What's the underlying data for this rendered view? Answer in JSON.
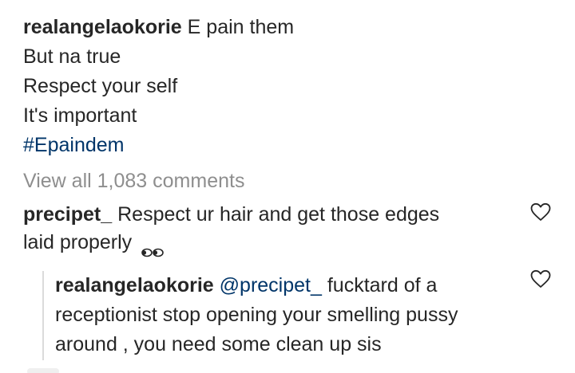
{
  "caption": {
    "username": "realangelaokorie",
    "first_line": "E pain them",
    "lines": [
      "But na true",
      "Respect your self",
      "It's important"
    ],
    "hashtag": "#Epaindem"
  },
  "view_all_comments": "View all 1,083 comments",
  "comments": [
    {
      "username": "precipet_",
      "text_line1": "Respect ur hair and get those edges",
      "text_line2": "laid properly",
      "emoji_icon": "eyes-emoji-icon",
      "reply": {
        "username": "realangelaokorie",
        "mention": "@precipet_",
        "text_line1": "fucktard of a",
        "text_line2": "receptionist stop opening your smelling pussy",
        "text_line3": "around , you need some clean up sis"
      }
    }
  ],
  "colors": {
    "text": "#262626",
    "link": "#003569",
    "muted": "#8e8e8e",
    "divider": "#dbdbdb"
  }
}
